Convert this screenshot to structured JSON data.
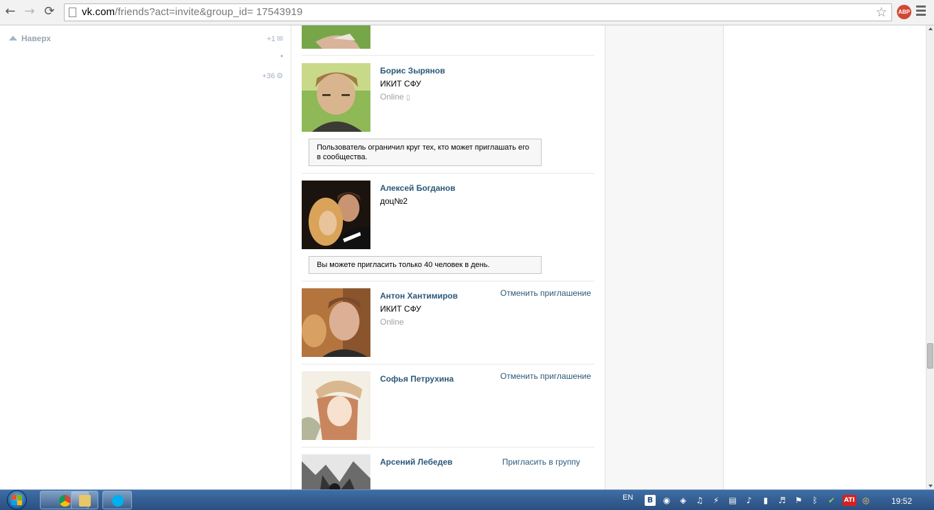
{
  "browser": {
    "url_host": "vk.com",
    "url_path": "/friends?act=invite&group_id= 17543919",
    "back_icon": "←",
    "forward_icon": "→",
    "reload_icon": "⟳",
    "abp_label": "ABP"
  },
  "sidebar": {
    "to_top_label": "Наверх",
    "mail_count": "+1",
    "settings_count": "+36"
  },
  "friends": [
    {
      "name": "Борис Зырянов",
      "info": "ИКИТ СФУ",
      "status": "Online",
      "notice": "Пользователь ограничил круг тех, кто может приглашать его в сообщества."
    },
    {
      "name": "Алексей Богданов",
      "info": "доц№2",
      "notice": "Вы можете пригласить только 40 человек в день."
    },
    {
      "name": "Антон Хантимиров",
      "info": "ИКИТ СФУ",
      "status": "Online",
      "action": "Отменить приглашение"
    },
    {
      "name": "Софья Петрухина",
      "action": "Отменить приглашение"
    },
    {
      "name": "Арсений Лебедев",
      "action": "Пригласить в группу"
    }
  ],
  "taskbar": {
    "lang": "EN",
    "clock": "19:52"
  },
  "colors": {
    "link": "#2b587a",
    "muted": "#a0a0a0",
    "taskbar": "#2a4f80"
  }
}
